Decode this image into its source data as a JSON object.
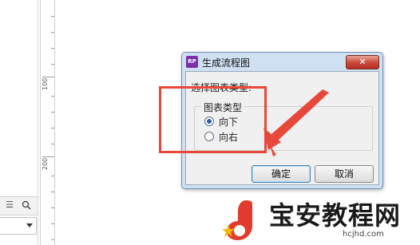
{
  "ruler": {
    "marks": [
      "100",
      "200"
    ]
  },
  "dialog": {
    "app_icon_text": "RP",
    "title": "生成流程图",
    "close_symbol": "✕",
    "prompt": "选择图表类型:",
    "group_title": "图表类型",
    "options": [
      {
        "label": "向下",
        "selected": true
      },
      {
        "label": "向右",
        "selected": false
      }
    ],
    "ok_label": "确定",
    "cancel_label": "取消"
  },
  "toolbar": {
    "menu_icon": "menu-icon",
    "search_icon": "search-icon"
  },
  "watermark": {
    "title": "宝安教程网",
    "url": "hcjhd.com"
  },
  "colors": {
    "annotation": "#e8483a",
    "dialog_frame": "#cfe0f3",
    "close_button": "#c9483a"
  }
}
